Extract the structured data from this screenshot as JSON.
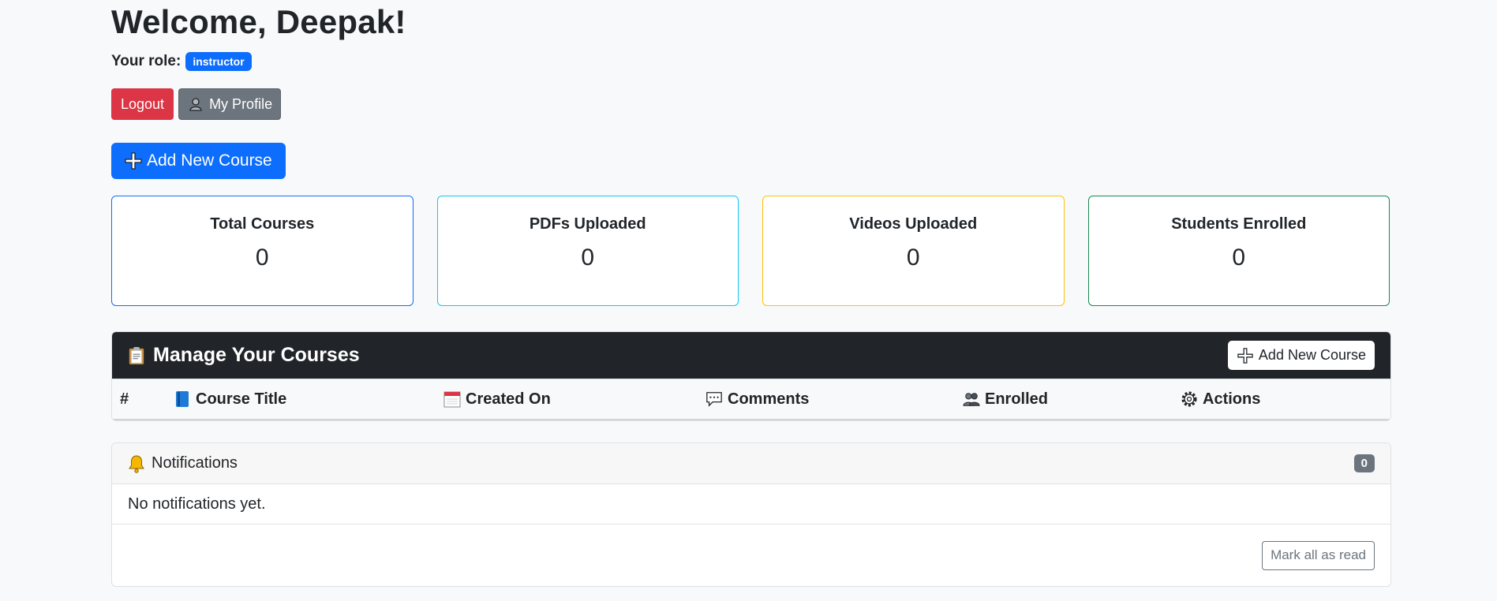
{
  "header": {
    "welcome": "Welcome, Deepak!",
    "role_label": "Your role:",
    "role_value": "instructor"
  },
  "buttons": {
    "logout": "Logout",
    "profile": "My Profile",
    "add_course": "Add New Course"
  },
  "stats": [
    {
      "label": "Total Courses",
      "value": "0",
      "color": "#0d6efd"
    },
    {
      "label": "PDFs Uploaded",
      "value": "0",
      "color": "#0dcaf0"
    },
    {
      "label": "Videos Uploaded",
      "value": "0",
      "color": "#ffc107"
    },
    {
      "label": "Students Enrolled",
      "value": "0",
      "color": "#198754"
    }
  ],
  "courses_table": {
    "title": "Manage Your Courses",
    "add_button": "Add New Course",
    "columns": [
      "#",
      "Course Title",
      "Created On",
      "Comments",
      "Enrolled",
      "Actions"
    ],
    "column_icons": [
      "",
      "blue-book-icon",
      "calendar-icon",
      "speech-bubble-icon",
      "users-icon",
      "gear-icon"
    ]
  },
  "notifications": {
    "title": "Notifications",
    "count": "0",
    "empty_text": "No notifications yet.",
    "mark_read": "Mark all as read"
  }
}
